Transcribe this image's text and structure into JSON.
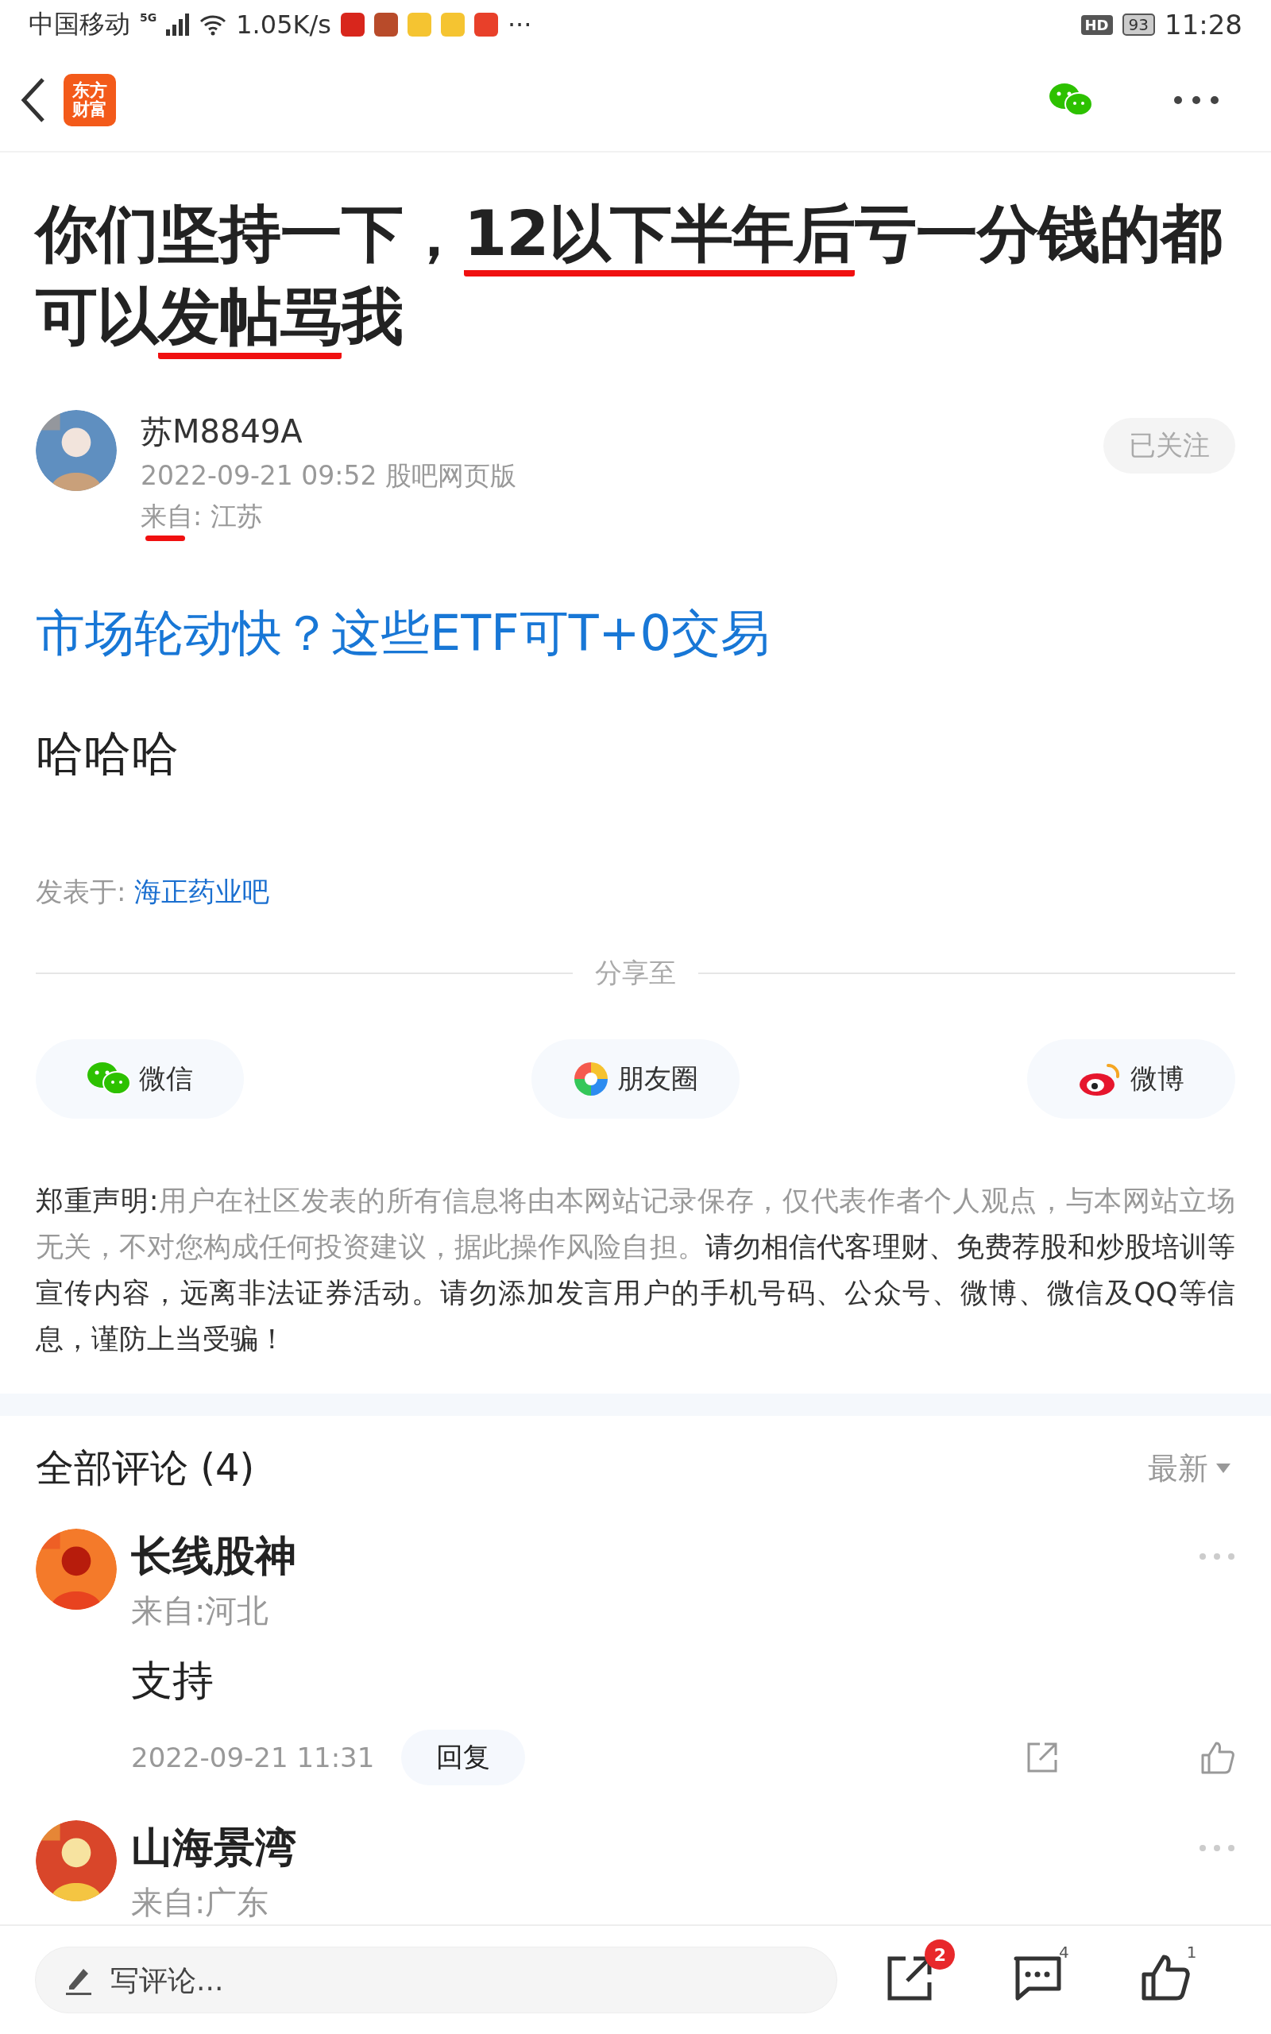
{
  "status_bar": {
    "carrier": "中国移动",
    "network": "5G",
    "speed": "1.05K/s",
    "more": "···",
    "hd": "HD",
    "battery": "93",
    "time": "11:28"
  },
  "header": {
    "logo_lines": [
      "东方",
      "财富"
    ]
  },
  "post": {
    "title": [
      {
        "text": "你们坚持一下，",
        "marked": false
      },
      {
        "text": "12以下半年后",
        "marked": true
      },
      {
        "text": "亏一分钱的都",
        "marked": false
      },
      {
        "text": "可以",
        "marked": false
      },
      {
        "text": "发帖骂",
        "marked": true
      },
      {
        "text": "我",
        "marked": false
      }
    ],
    "author": {
      "name": "苏M8849A",
      "meta": "2022-09-21 09:52 股吧网页版",
      "location": "来自: 江苏",
      "follow": {
        "label": "已关注",
        "followed": true
      }
    },
    "link": "市场轮动快？这些ETF可T+0交易",
    "body": "哈哈哈",
    "posted_in": {
      "label": "发表于:",
      "bar": "海正药业吧"
    }
  },
  "share": {
    "title": "分享至",
    "items": [
      {
        "kind": "wechat",
        "label": "微信"
      },
      {
        "kind": "moments",
        "label": "朋友圈"
      },
      {
        "kind": "weibo",
        "label": "微博"
      }
    ]
  },
  "disclaimer": {
    "label": "郑重声明:",
    "muted_text": "用户在社区发表的所有信息将由本网站记录保存，仅代表作者个人观点，与本网站立场无关，不对您构成任何投资建议，据此操作风险自担。",
    "text": "请勿相信代客理财、免费荐股和炒股培训等宣传内容，远离非法证券活动。请勿添加发言用户的手机号码、公众号、微博、微信及QQ等信息，谨防上当受骗！"
  },
  "comments": {
    "title": "全部评论",
    "count": "(4)",
    "sort": "最新",
    "items": [
      {
        "name": "长线股神",
        "location": "来自:河北",
        "text": "支持",
        "time": "2022-09-21 11:31",
        "reply": "回复"
      },
      {
        "name": "山海景湾",
        "location": "来自:广东"
      }
    ]
  },
  "bottom_bar": {
    "placeholder": "写评论...",
    "share_badge": "2",
    "comments_count": "4",
    "likes_count": "1"
  }
}
